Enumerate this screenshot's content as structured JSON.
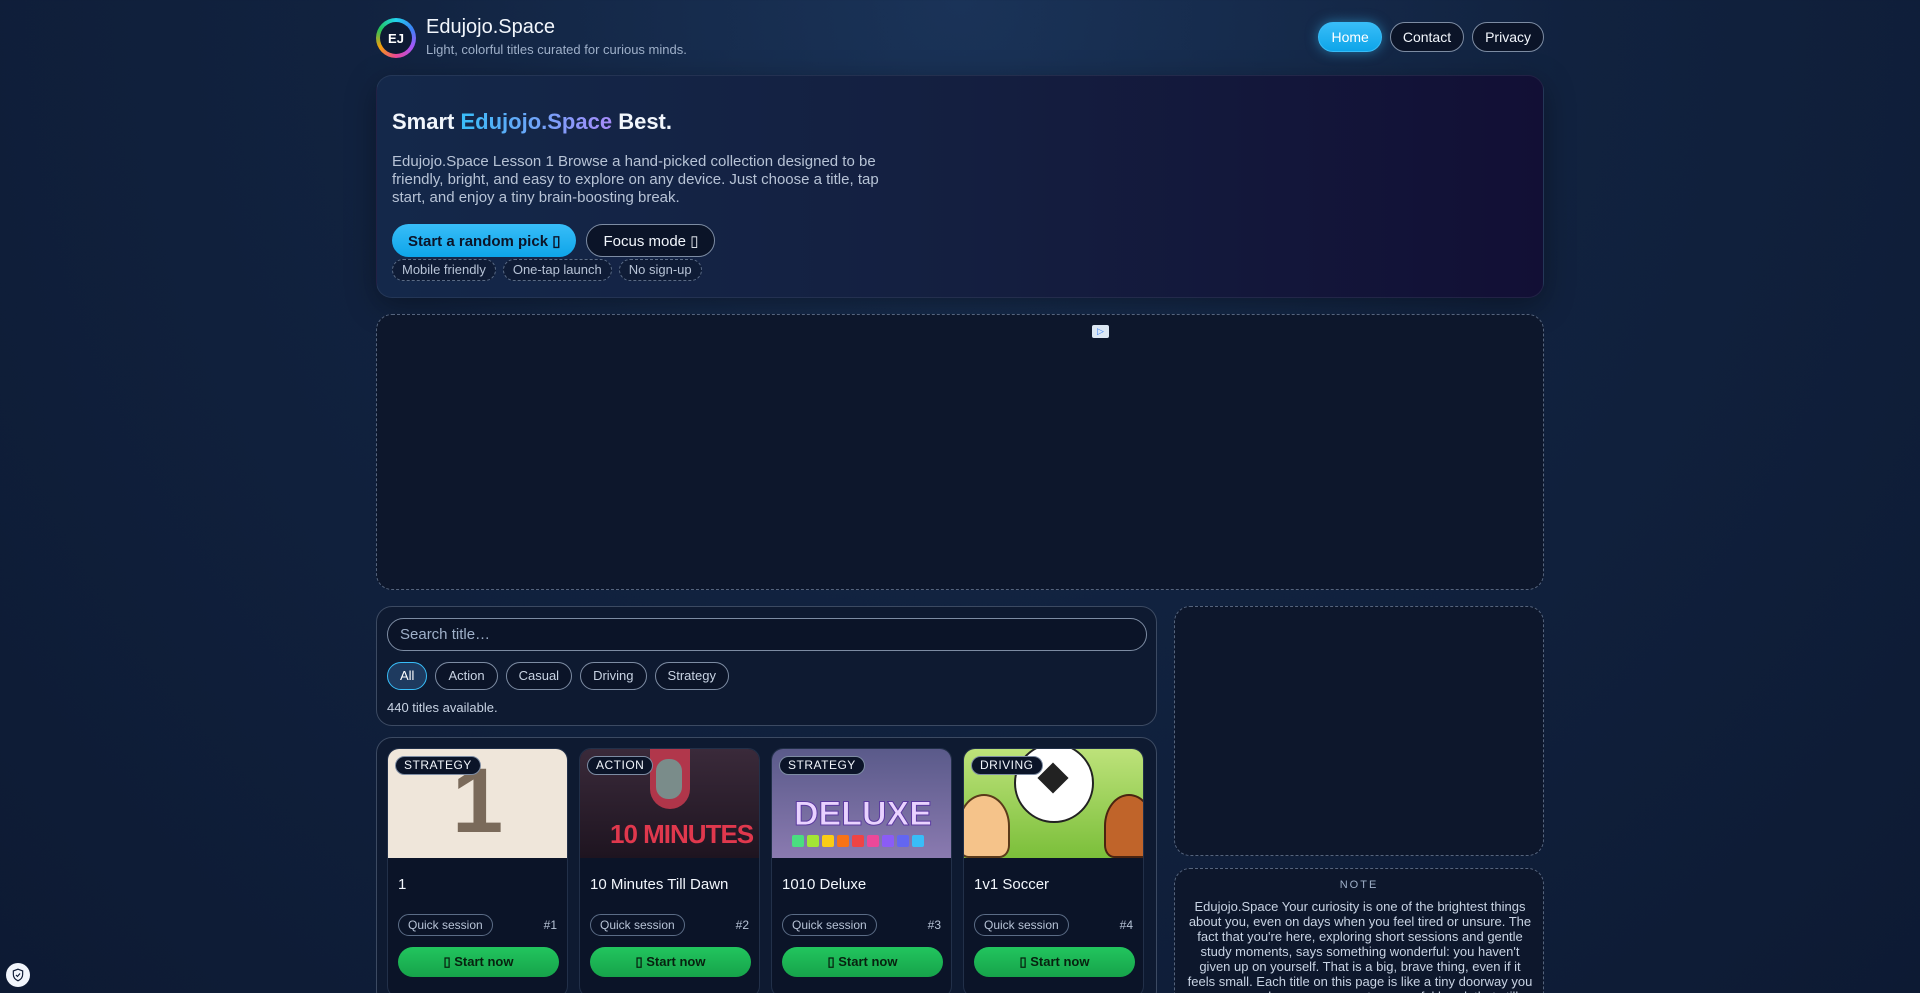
{
  "brand": {
    "logo_text": "EJ",
    "name": "Edujojo.Space",
    "tagline": "Light, colorful titles curated for curious minds."
  },
  "nav": [
    {
      "label": "Home",
      "active": true
    },
    {
      "label": "Contact",
      "active": false
    },
    {
      "label": "Privacy",
      "active": false
    }
  ],
  "hero": {
    "title_prefix": "Smart ",
    "title_accent": "Edujojo.Space",
    "title_suffix": " Best.",
    "description": "Edujojo.Space Lesson 1 Browse a hand-picked collection designed to be friendly, bright, and easy to explore on any device. Just choose a title, tap start, and enjoy a tiny brain-boosting break.",
    "primary_button": "Start a random pick",
    "secondary_button": "Focus mode",
    "pills": [
      "Mobile friendly",
      "One-tap launch",
      "No sign-up"
    ]
  },
  "search": {
    "placeholder": "Search title…",
    "filters": [
      "All",
      "Action",
      "Casual",
      "Driving",
      "Strategy"
    ],
    "active_filter": "All",
    "count_text": "440 titles available."
  },
  "cards": [
    {
      "category": "STRATEGY",
      "title": "1",
      "session": "Quick session",
      "number": "#1",
      "button": "Start now",
      "thumb_text": "1"
    },
    {
      "category": "ACTION",
      "title": "10 Minutes Till Dawn",
      "session": "Quick session",
      "number": "#2",
      "button": "Start now",
      "thumb_text": "10 MINUTES"
    },
    {
      "category": "STRATEGY",
      "title": "1010 Deluxe",
      "session": "Quick session",
      "number": "#3",
      "button": "Start now",
      "thumb_text": "DELUXE"
    },
    {
      "category": "DRIVING",
      "title": "1v1 Soccer",
      "session": "Quick session",
      "number": "#4",
      "button": "Start now"
    }
  ],
  "note": {
    "label": "NOTE",
    "body": "Edujojo.Space Your curiosity is one of the brightest things about you, even on days when you feel tired or unsure. The fact that you're here, exploring short sessions and gentle study moments, says something wonderful: you haven't given up on yourself. That is a big, brave thing, even if it feels small. Each title on this page is like a tiny doorway you can open whenever you want a peaceful break that still feels"
  },
  "colors": {
    "accent": "#38bdf8",
    "start_button": "#22c55e",
    "background": "#11223f"
  },
  "icons": {
    "primary_button_icon": "random-icon",
    "secondary_button_icon": "focus-icon",
    "start_icon": "play-icon",
    "ad_choices": "adchoices-icon",
    "privacy_widget": "shield-icon"
  }
}
